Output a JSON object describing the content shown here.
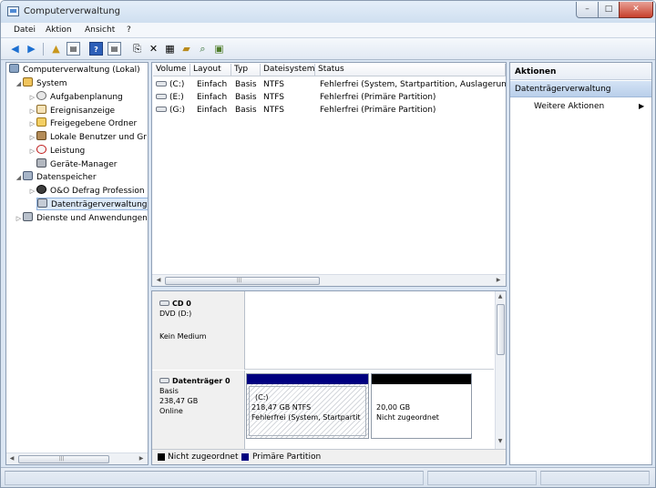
{
  "window": {
    "title": "Computerverwaltung",
    "controls": {
      "minimize": "–",
      "maximize": "□",
      "close": "✕"
    }
  },
  "menu": {
    "items": [
      "Datei",
      "Aktion",
      "Ansicht",
      "?"
    ]
  },
  "toolbar": {
    "icons": [
      "back-icon",
      "forward-icon",
      "up-folder-icon",
      "show-hide-tree-icon",
      "help-icon",
      "properties-icon",
      "refresh-icon",
      "delete-icon",
      "icon-a",
      "icon-b",
      "icon-c",
      "icon-d"
    ]
  },
  "tree": {
    "items": [
      {
        "label": "Computerverwaltung (Lokal)",
        "icon": "computer-management-icon"
      },
      {
        "label": "System",
        "icon": "system-tools-icon",
        "expander": "◢"
      },
      {
        "label": "Aufgabenplanung",
        "icon": "task-scheduler-icon",
        "expander": "▷"
      },
      {
        "label": "Ereignisanzeige",
        "icon": "event-viewer-icon",
        "expander": "▷"
      },
      {
        "label": "Freigegebene Ordner",
        "icon": "shared-folders-icon",
        "expander": "▷"
      },
      {
        "label": "Lokale Benutzer und Gr",
        "icon": "local-users-icon",
        "expander": "▷"
      },
      {
        "label": "Leistung",
        "icon": "performance-icon",
        "expander": "▷"
      },
      {
        "label": "Geräte-Manager",
        "icon": "device-manager-icon"
      },
      {
        "label": "Datenspeicher",
        "icon": "storage-icon",
        "expander": "◢"
      },
      {
        "label": "O&O Defrag Profession",
        "icon": "defrag-icon",
        "expander": "▷"
      },
      {
        "label": "Datenträgerverwaltung",
        "icon": "disk-management-icon"
      },
      {
        "label": "Dienste und Anwendungen",
        "icon": "services-icon",
        "expander": "▷"
      }
    ]
  },
  "volumes": {
    "columns": [
      "Volume",
      "Layout",
      "Typ",
      "Dateisystem",
      "Status"
    ],
    "rows": [
      {
        "volume": "(C:)",
        "layout": "Einfach",
        "typ": "Basis",
        "fs": "NTFS",
        "status": "Fehlerfrei (System, Startpartition, Auslagerungs-"
      },
      {
        "volume": "(E:)",
        "layout": "Einfach",
        "typ": "Basis",
        "fs": "NTFS",
        "status": "Fehlerfrei (Primäre Partition)"
      },
      {
        "volume": "(G:)",
        "layout": "Einfach",
        "typ": "Basis",
        "fs": "NTFS",
        "status": "Fehlerfrei (Primäre Partition)"
      }
    ]
  },
  "disks": {
    "cd": {
      "name": "CD 0",
      "type": "DVD (D:)",
      "status": "Kein Medium"
    },
    "disk0": {
      "name": "Datenträger 0",
      "type": "Basis",
      "size": "238,47 GB",
      "status": "Online",
      "partitions": [
        {
          "label": "(C:)",
          "size": "218,47 GB NTFS",
          "status": "Fehlerfrei (System, Startpartit"
        },
        {
          "label": "",
          "size": "20,00 GB",
          "status": "Nicht zugeordnet"
        }
      ]
    }
  },
  "legend": {
    "unallocated": "Nicht zugeordnet",
    "primary": "Primäre Partition",
    "unallocated_color": "#000000",
    "primary_color": "#00007f"
  },
  "actions": {
    "title": "Aktionen",
    "section": "Datenträgerverwaltung",
    "more": "Weitere Aktionen",
    "more_arrow": "▶"
  }
}
